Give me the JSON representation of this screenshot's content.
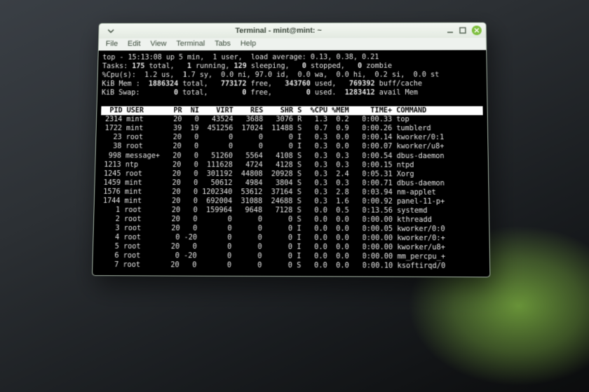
{
  "window": {
    "title": "Terminal - mint@mint: ~",
    "menu": [
      "File",
      "Edit",
      "View",
      "Terminal",
      "Tabs",
      "Help"
    ]
  },
  "top": {
    "line1": "top - 15:13:08 up 5 min,  1 user,  load average: 0.13, 0.38, 0.21",
    "tasks": {
      "pre": "Tasks:",
      "total": "175",
      "total_l": "total,",
      "run": "1",
      "run_l": "running,",
      "sleep": "129",
      "sleep_l": "sleeping,",
      "stop": "0",
      "stop_l": "stopped,",
      "zomb": "0",
      "zomb_l": "zombie"
    },
    "cpu": "%Cpu(s):  1.2 us,  1.7 sy,  0.0 ni, 97.0 id,  0.0 wa,  0.0 hi,  0.2 si,  0.0 st",
    "mem": {
      "pre": "KiB Mem :",
      "total": "1886324",
      "total_l": "total,",
      "free": "773172",
      "free_l": "free,",
      "used": "343760",
      "used_l": "used,",
      "buff": "769392",
      "buff_l": "buff/cache"
    },
    "swap": {
      "pre": "KiB Swap:",
      "total": "0",
      "total_l": "total,",
      "free": "0",
      "free_l": "free,",
      "used": "0",
      "used_l": "used.",
      "avail": "1283412",
      "avail_l": "avail Mem"
    },
    "hdr": {
      "pid": "PID",
      "user": "USER",
      "pr": "PR",
      "ni": "NI",
      "virt": "VIRT",
      "res": "RES",
      "shr": "SHR",
      "s": "S",
      "cpu": "%CPU",
      "mem": "%MEM",
      "time": "TIME+",
      "cmd": "COMMAND"
    }
  },
  "rows": [
    {
      "pid": "2314",
      "user": "mint",
      "pr": "20",
      "ni": "0",
      "virt": "43524",
      "res": "3688",
      "shr": "3076",
      "s": "R",
      "cpu": "1.3",
      "mem": "0.2",
      "time": "0:00.33",
      "cmd": "top"
    },
    {
      "pid": "1722",
      "user": "mint",
      "pr": "39",
      "ni": "19",
      "virt": "451256",
      "res": "17024",
      "shr": "11488",
      "s": "S",
      "cpu": "0.7",
      "mem": "0.9",
      "time": "0:00.26",
      "cmd": "tumblerd"
    },
    {
      "pid": "23",
      "user": "root",
      "pr": "20",
      "ni": "0",
      "virt": "0",
      "res": "0",
      "shr": "0",
      "s": "I",
      "cpu": "0.3",
      "mem": "0.0",
      "time": "0:00.14",
      "cmd": "kworker/0:1"
    },
    {
      "pid": "38",
      "user": "root",
      "pr": "20",
      "ni": "0",
      "virt": "0",
      "res": "0",
      "shr": "0",
      "s": "I",
      "cpu": "0.3",
      "mem": "0.0",
      "time": "0:00.07",
      "cmd": "kworker/u8+"
    },
    {
      "pid": "998",
      "user": "message+",
      "pr": "20",
      "ni": "0",
      "virt": "51260",
      "res": "5564",
      "shr": "4108",
      "s": "S",
      "cpu": "0.3",
      "mem": "0.3",
      "time": "0:00.54",
      "cmd": "dbus-daemon"
    },
    {
      "pid": "1213",
      "user": "ntp",
      "pr": "20",
      "ni": "0",
      "virt": "111628",
      "res": "4724",
      "shr": "4128",
      "s": "S",
      "cpu": "0.3",
      "mem": "0.3",
      "time": "0:00.15",
      "cmd": "ntpd"
    },
    {
      "pid": "1245",
      "user": "root",
      "pr": "20",
      "ni": "0",
      "virt": "301192",
      "res": "44808",
      "shr": "20928",
      "s": "S",
      "cpu": "0.3",
      "mem": "2.4",
      "time": "0:05.31",
      "cmd": "Xorg"
    },
    {
      "pid": "1459",
      "user": "mint",
      "pr": "20",
      "ni": "0",
      "virt": "50612",
      "res": "4984",
      "shr": "3804",
      "s": "S",
      "cpu": "0.3",
      "mem": "0.3",
      "time": "0:00.71",
      "cmd": "dbus-daemon"
    },
    {
      "pid": "1576",
      "user": "mint",
      "pr": "20",
      "ni": "0",
      "virt": "1202340",
      "res": "53612",
      "shr": "37164",
      "s": "S",
      "cpu": "0.3",
      "mem": "2.8",
      "time": "0:03.94",
      "cmd": "nm-applet"
    },
    {
      "pid": "1744",
      "user": "mint",
      "pr": "20",
      "ni": "0",
      "virt": "692004",
      "res": "31088",
      "shr": "24688",
      "s": "S",
      "cpu": "0.3",
      "mem": "1.6",
      "time": "0:00.92",
      "cmd": "panel-11-p+"
    },
    {
      "pid": "1",
      "user": "root",
      "pr": "20",
      "ni": "0",
      "virt": "159964",
      "res": "9648",
      "shr": "7128",
      "s": "S",
      "cpu": "0.0",
      "mem": "0.5",
      "time": "0:13.56",
      "cmd": "systemd"
    },
    {
      "pid": "2",
      "user": "root",
      "pr": "20",
      "ni": "0",
      "virt": "0",
      "res": "0",
      "shr": "0",
      "s": "S",
      "cpu": "0.0",
      "mem": "0.0",
      "time": "0:00.00",
      "cmd": "kthreadd"
    },
    {
      "pid": "3",
      "user": "root",
      "pr": "20",
      "ni": "0",
      "virt": "0",
      "res": "0",
      "shr": "0",
      "s": "I",
      "cpu": "0.0",
      "mem": "0.0",
      "time": "0:00.05",
      "cmd": "kworker/0:0"
    },
    {
      "pid": "4",
      "user": "root",
      "pr": "0",
      "ni": "-20",
      "virt": "0",
      "res": "0",
      "shr": "0",
      "s": "I",
      "cpu": "0.0",
      "mem": "0.0",
      "time": "0:00.00",
      "cmd": "kworker/0:+"
    },
    {
      "pid": "5",
      "user": "root",
      "pr": "20",
      "ni": "0",
      "virt": "0",
      "res": "0",
      "shr": "0",
      "s": "I",
      "cpu": "0.0",
      "mem": "0.0",
      "time": "0:00.00",
      "cmd": "kworker/u8+"
    },
    {
      "pid": "6",
      "user": "root",
      "pr": "0",
      "ni": "-20",
      "virt": "0",
      "res": "0",
      "shr": "0",
      "s": "I",
      "cpu": "0.0",
      "mem": "0.0",
      "time": "0:00.00",
      "cmd": "mm_percpu_+"
    },
    {
      "pid": "7",
      "user": "root",
      "pr": "20",
      "ni": "0",
      "virt": "0",
      "res": "0",
      "shr": "0",
      "s": "S",
      "cpu": "0.0",
      "mem": "0.0",
      "time": "0:00.10",
      "cmd": "ksoftirqd/0"
    }
  ]
}
